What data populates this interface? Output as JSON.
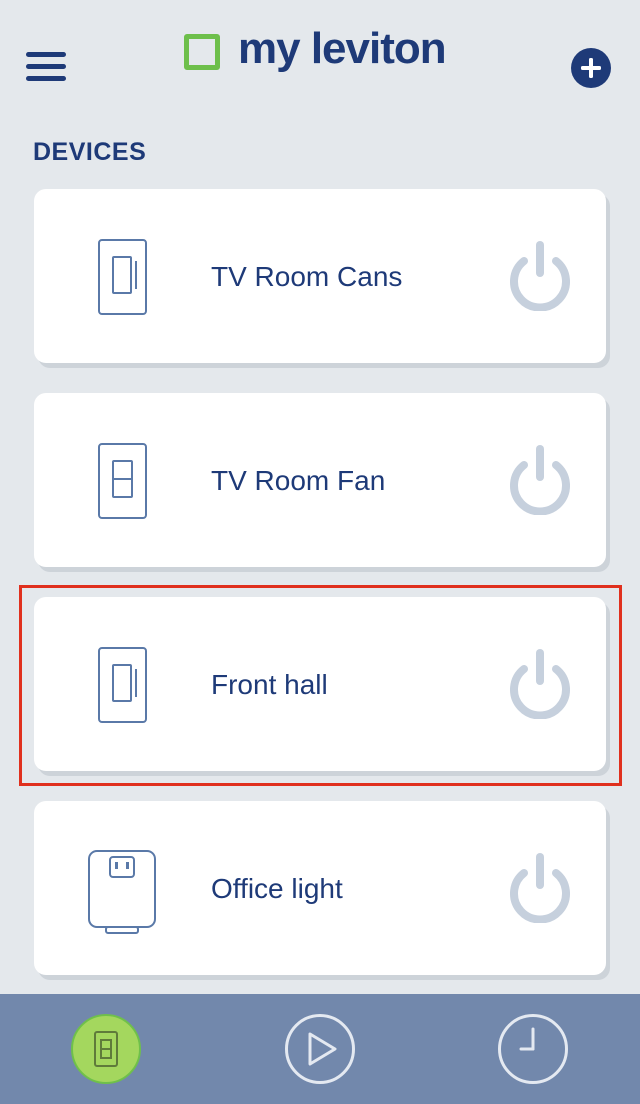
{
  "header": {
    "menu_icon": "hamburger-menu-icon",
    "logo_text": "my leviton",
    "add_icon": "plus-icon",
    "colors": {
      "brand_blue": "#1e3a78",
      "brand_green": "#6dbf4b",
      "background": "#e4e8ec"
    }
  },
  "devices": {
    "section_title": "DEVICES",
    "items": [
      {
        "name": "TV Room Cans",
        "device_icon": "dimmer-switch-icon",
        "power_icon": "power-icon"
      },
      {
        "name": "TV Room Fan",
        "device_icon": "fan-speed-control-icon",
        "power_icon": "power-icon"
      },
      {
        "name": "Front hall",
        "device_icon": "dimmer-switch-icon",
        "power_icon": "power-icon"
      },
      {
        "name": "Office light",
        "device_icon": "plug-in-dimmer-icon",
        "power_icon": "power-icon"
      }
    ]
  },
  "tabbar": {
    "tabs": [
      {
        "icon": "devices-switch-icon",
        "active": true
      },
      {
        "icon": "play-scenes-icon",
        "active": false
      },
      {
        "icon": "clock-schedules-icon",
        "active": false
      }
    ],
    "colors": {
      "bar": "#7288ac",
      "active": "#a4d75e"
    }
  }
}
